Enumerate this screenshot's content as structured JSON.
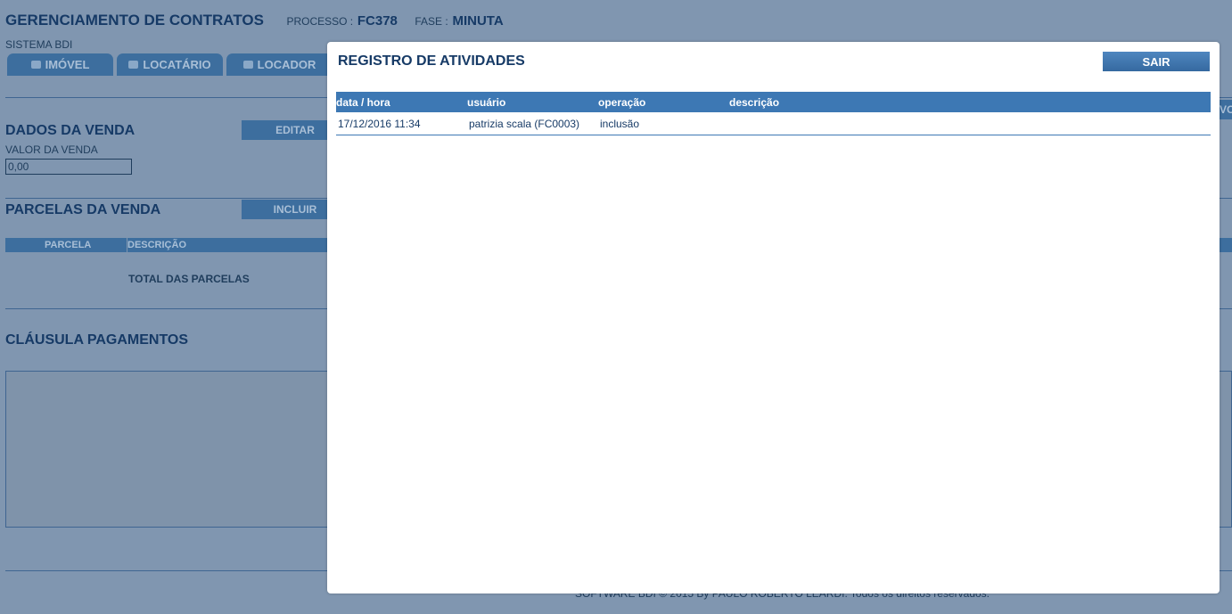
{
  "header": {
    "title": "GERENCIAMENTO DE CONTRATOS",
    "processo_label": "PROCESSO :",
    "processo_value": "FC378",
    "fase_label": "FASE :",
    "fase_value": "MINUTA",
    "system": "SISTEMA BDI"
  },
  "tabs": [
    {
      "label": "IMÓVEL",
      "icon": "people-icon"
    },
    {
      "label": "LOCATÁRIO",
      "icon": "people-icon"
    },
    {
      "label": "LOCADOR",
      "icon": "card-icon"
    }
  ],
  "dados_venda": {
    "title": "DADOS DA VENDA",
    "edit_label": "EDITAR",
    "valor_label": "VALOR DA VENDA",
    "valor_value": "0,00"
  },
  "parcelas": {
    "title": "PARCELAS DA VENDA",
    "include_label": "INCLUIR",
    "columns": [
      "PARCELA",
      "DESCRIÇÃO"
    ],
    "total_label": "TOTAL DAS PARCELAS"
  },
  "clausula": {
    "title": "CLÁUSULA PAGAMENTOS"
  },
  "edge_button": "VO",
  "footer": "SOFTWARE BDI © 2015 By PAULO ROBERTO LEARDI. Todos os direitos reservados.",
  "modal": {
    "title": "REGISTRO DE ATIVIDADES",
    "close_label": "SAIR",
    "columns": [
      "data / hora",
      "usuário",
      "operação",
      "descrição"
    ],
    "rows": [
      {
        "datahora": "17/12/2016 11:34",
        "usuario": "patrizia scala (FC0003)",
        "operacao": "inclusão",
        "descricao": ""
      }
    ]
  },
  "colors": {
    "overlay_bg": "#8096b0",
    "accent": "#3d78b4",
    "title": "#163a66"
  }
}
